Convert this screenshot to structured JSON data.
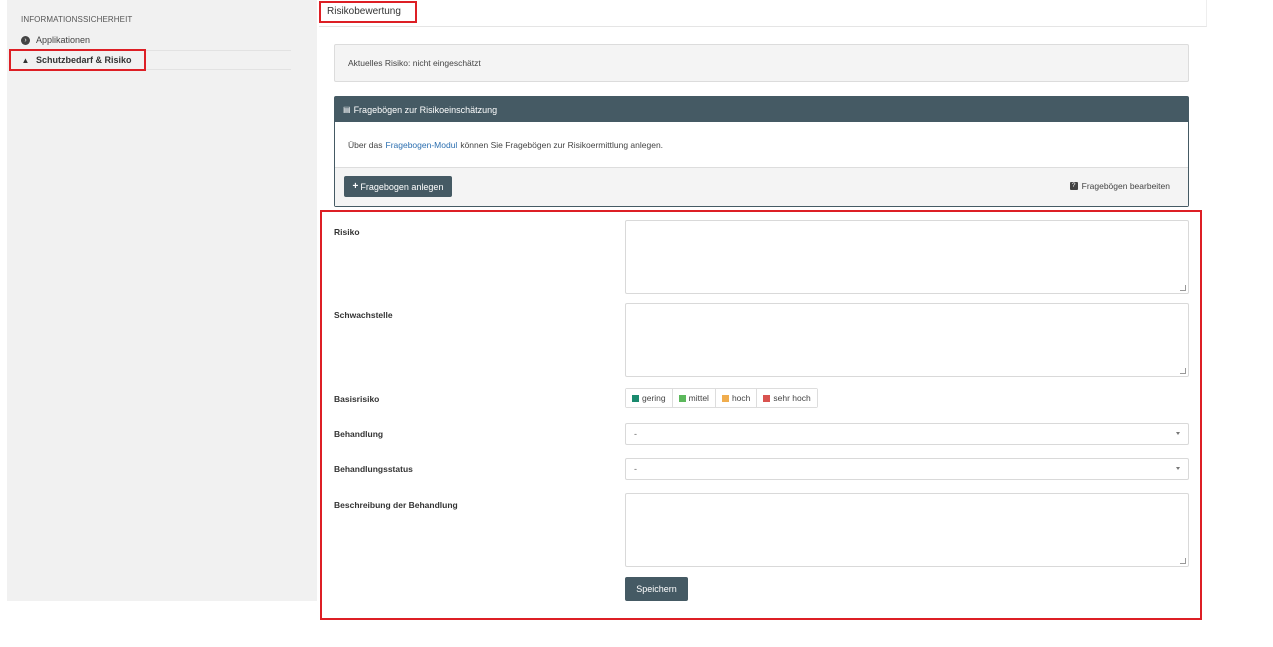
{
  "sidebar": {
    "section_title": "INFORMATIONSSICHERHEIT",
    "items": [
      {
        "label": "Applikationen",
        "icon": "circle-arrow-icon"
      },
      {
        "label": "Schutzbedarf & Risiko",
        "icon": "warning-icon"
      }
    ]
  },
  "tabs": {
    "active": "Risikobewertung"
  },
  "alert": {
    "text": "Aktuelles Risiko: nicht eingeschätzt"
  },
  "questionnaire_panel": {
    "title": "Fragebögen zur Risikoeinschätzung",
    "title_icon": "clipboard-icon",
    "body_prefix": "Über das",
    "body_link": "Fragebogen-Modul",
    "body_suffix": "können Sie Fragebögen zur Risikoermittlung anlegen.",
    "add_button": "Fragebogen anlegen",
    "edit_link": "Fragebögen bearbeiten"
  },
  "form": {
    "risk_label": "Risiko",
    "risk_value": "",
    "weakness_label": "Schwachstelle",
    "weakness_value": "",
    "base_risk_label": "Basisrisiko",
    "base_risk_options": [
      {
        "label": "gering",
        "color": "#1a8a6e"
      },
      {
        "label": "mittel",
        "color": "#5cb85c"
      },
      {
        "label": "hoch",
        "color": "#f0ad4e"
      },
      {
        "label": "sehr hoch",
        "color": "#d9534f"
      }
    ],
    "treatment_label": "Behandlung",
    "treatment_value": "-",
    "treatment_status_label": "Behandlungsstatus",
    "treatment_status_value": "-",
    "treatment_desc_label": "Beschreibung der Behandlung",
    "treatment_desc_value": "",
    "save_button": "Speichern"
  },
  "colors": {
    "highlight": "#dd1f25",
    "panel_header": "#455a64",
    "link": "#2c6fb0"
  }
}
